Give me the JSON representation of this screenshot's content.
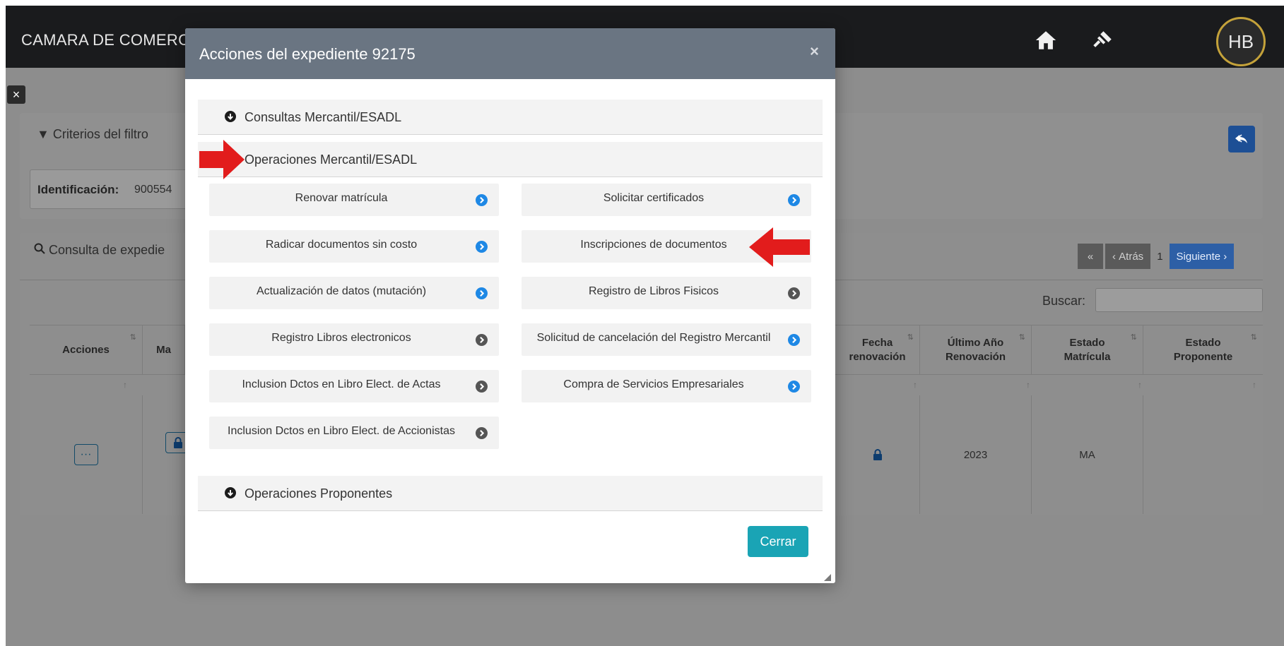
{
  "header": {
    "app_title": "CAMARA DE COMERCIO",
    "avatar_initials": "HB"
  },
  "filter_card": {
    "title": "Criterios del filtro",
    "identificacion_label": "Identificación:",
    "identificacion_value": "900554"
  },
  "results_card": {
    "title": "Consulta de expedie",
    "pager": {
      "back": "Atrás",
      "page": "1",
      "next": "Siguiente"
    },
    "search_label": "Buscar:",
    "columns": [
      {
        "label": "Acciones"
      },
      {
        "label": "Ma"
      },
      {
        "label": "Fecha renovación"
      },
      {
        "label": "Último Año Renovación"
      },
      {
        "label": "Estado Matrícula"
      },
      {
        "label": "Estado Proponente"
      }
    ],
    "row": {
      "ultimo_anio": "2023",
      "estado_matricula": "MA"
    }
  },
  "modal": {
    "title": "Acciones del expediente 92175",
    "close_label": "Cerrar",
    "sections": [
      {
        "label": "Consultas Mercantil/ESADL"
      },
      {
        "label": "Operaciones Mercantil/ESADL"
      },
      {
        "label": "Operaciones Proponentes"
      }
    ],
    "operations": [
      {
        "label": "Renovar matrícula",
        "status": "active"
      },
      {
        "label": "Solicitar certificados",
        "status": "active"
      },
      {
        "label": "Radicar documentos sin costo",
        "status": "active"
      },
      {
        "label": "Inscripciones de documentos",
        "status": "active"
      },
      {
        "label": "Actualización de datos (mutación)",
        "status": "active"
      },
      {
        "label": "Registro de Libros Fisicos",
        "status": "inactive"
      },
      {
        "label": "Registro Libros electronicos",
        "status": "inactive"
      },
      {
        "label": "Solicitud de cancelación del Registro Mercantil",
        "status": "active"
      },
      {
        "label": "Inclusion Dctos en Libro Elect. de Actas",
        "status": "inactive"
      },
      {
        "label": "Compra de Servicios Empresariales",
        "status": "active"
      },
      {
        "label": "Inclusion Dctos en Libro Elect. de Accionistas",
        "status": "inactive"
      }
    ]
  },
  "colors": {
    "modal_header": "#6a7582",
    "chevron_active": "#1e88e5",
    "chevron_inactive": "#555555",
    "cerrar_button": "#1aa4b5",
    "annotation_arrow": "#e21c1c"
  }
}
